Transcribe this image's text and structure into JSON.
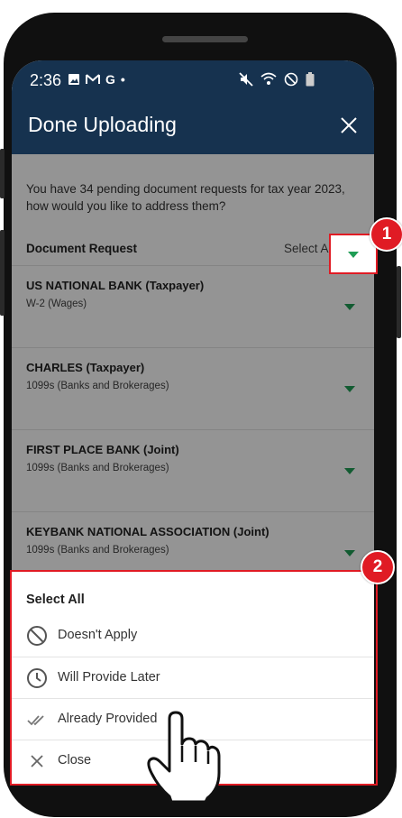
{
  "status": {
    "time": "2:36",
    "g_letter": "G",
    "dot": "•"
  },
  "header": {
    "title": "Done Uploading"
  },
  "intro": "You have 34 pending document requests for tax year 2023, how would you like to address them?",
  "list_header": {
    "label": "Document Request",
    "select_all": "Select All"
  },
  "rows": [
    {
      "title": "US NATIONAL BANK (Taxpayer)",
      "subtitle": "W-2 (Wages)"
    },
    {
      "title": "CHARLES  (Taxpayer)",
      "subtitle": "1099s (Banks and Brokerages)"
    },
    {
      "title": "FIRST PLACE BANK  (Joint)",
      "subtitle": "1099s (Banks and Brokerages)"
    },
    {
      "title": "KEYBANK NATIONAL ASSOCIATION  (Joint)",
      "subtitle": "1099s (Banks and Brokerages)"
    }
  ],
  "sheet": {
    "title": "Select All",
    "options": [
      {
        "label": "Doesn't Apply",
        "icon": "block-icon"
      },
      {
        "label": "Will Provide Later",
        "icon": "clock-icon"
      },
      {
        "label": "Already Provided",
        "icon": "double-check-icon"
      },
      {
        "label": "Close",
        "icon": "close-icon"
      }
    ]
  },
  "callouts": {
    "one": "1",
    "two": "2"
  },
  "colors": {
    "header": "#16324f",
    "accent_green": "#1f9d55",
    "callout_red": "#e01b24"
  }
}
